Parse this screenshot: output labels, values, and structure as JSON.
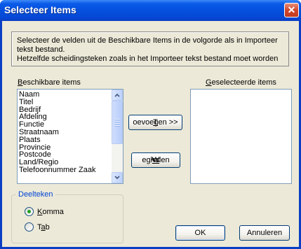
{
  "window": {
    "title": "Selecteer Items",
    "close_glyph": "✕"
  },
  "info": {
    "line1": "Selecteer de velden uit de Beschikbare Items in de volgorde als in Importeer tekst bestand.",
    "line2": "Hetzelfde scheidingsteken zoals in het Importeer tekst bestand moet worden"
  },
  "available": {
    "label_mnemonic": "B",
    "label_rest": "eschikbare items",
    "items": [
      "Naam",
      "Titel",
      "Bedrijf",
      "Afdeling",
      "Functie",
      "Straatnaam",
      "Plaats",
      "Provincie",
      "Postcode",
      "Land/Regio",
      "Telefoonnummer Zaak"
    ]
  },
  "selected": {
    "label_mnemonic": "G",
    "label_rest": "eselecteerde items",
    "items": []
  },
  "buttons": {
    "add_mnemonic": "T",
    "add_rest": "oevoegen >>",
    "remove_prefix": "<< ",
    "remove_mnemonic": "W",
    "remove_rest": "eghalen",
    "ok": "OK",
    "cancel": "Annuleren"
  },
  "delimiter": {
    "label": "Deelteken",
    "comma_mnemonic": "K",
    "comma_rest": "omma",
    "tab_prefix": "T",
    "tab_mnemonic": "a",
    "tab_rest": "b",
    "selected": "Komma"
  },
  "colors": {
    "titlebar": "#0550de",
    "dialog_bg": "#ece9d8",
    "radio_checked": "#21a121",
    "group_label": "#0046d5"
  },
  "icons": {
    "close": "close-icon",
    "scroll_up": "chevron-up-icon",
    "scroll_down": "chevron-down-icon"
  }
}
